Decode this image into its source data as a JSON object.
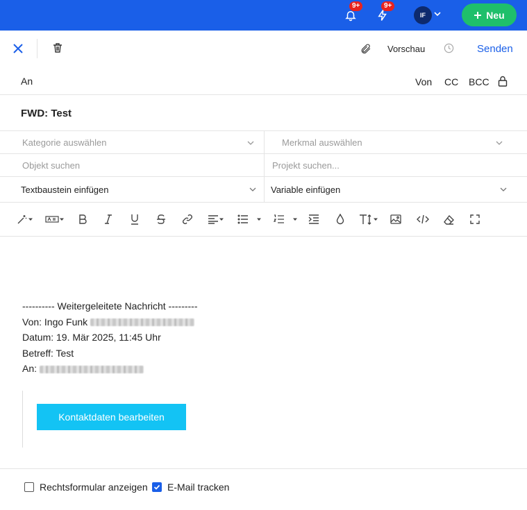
{
  "topbar": {
    "notifications_badge": "9+",
    "activity_badge": "9+",
    "avatar_initials": "IF",
    "new_label": "Neu"
  },
  "actions": {
    "preview_label": "Vorschau",
    "send_label": "Senden"
  },
  "recipients": {
    "to_label": "An",
    "from_label": "Von",
    "cc_label": "CC",
    "bcc_label": "BCC"
  },
  "subject": "FWD: Test",
  "selects": {
    "category_placeholder": "Kategorie auswählen",
    "feature_placeholder": "Merkmal auswählen",
    "object_placeholder": "Objekt suchen",
    "project_placeholder": "Projekt suchen...",
    "textblock_label": "Textbaustein einfügen",
    "variable_label": "Variable einfügen"
  },
  "body": {
    "forward_header": "---------- Weitergeleitete Nachricht ---------",
    "from_line": "Von: Ingo Funk",
    "date_line": "Datum: 19. Mär 2025, 11:45 Uhr",
    "subject_line": "Betreff: Test",
    "to_line": "An:",
    "contact_button": "Kontaktdaten bearbeiten"
  },
  "footer": {
    "legal_form_label": "Rechtsformular anzeigen",
    "legal_form_checked": false,
    "track_label": "E-Mail tracken",
    "track_checked": true
  },
  "colors": {
    "brand_blue": "#1a5fe8",
    "new_green": "#1fbf6b",
    "badge_red": "#e8231e",
    "contact_cyan": "#13c3f4"
  }
}
